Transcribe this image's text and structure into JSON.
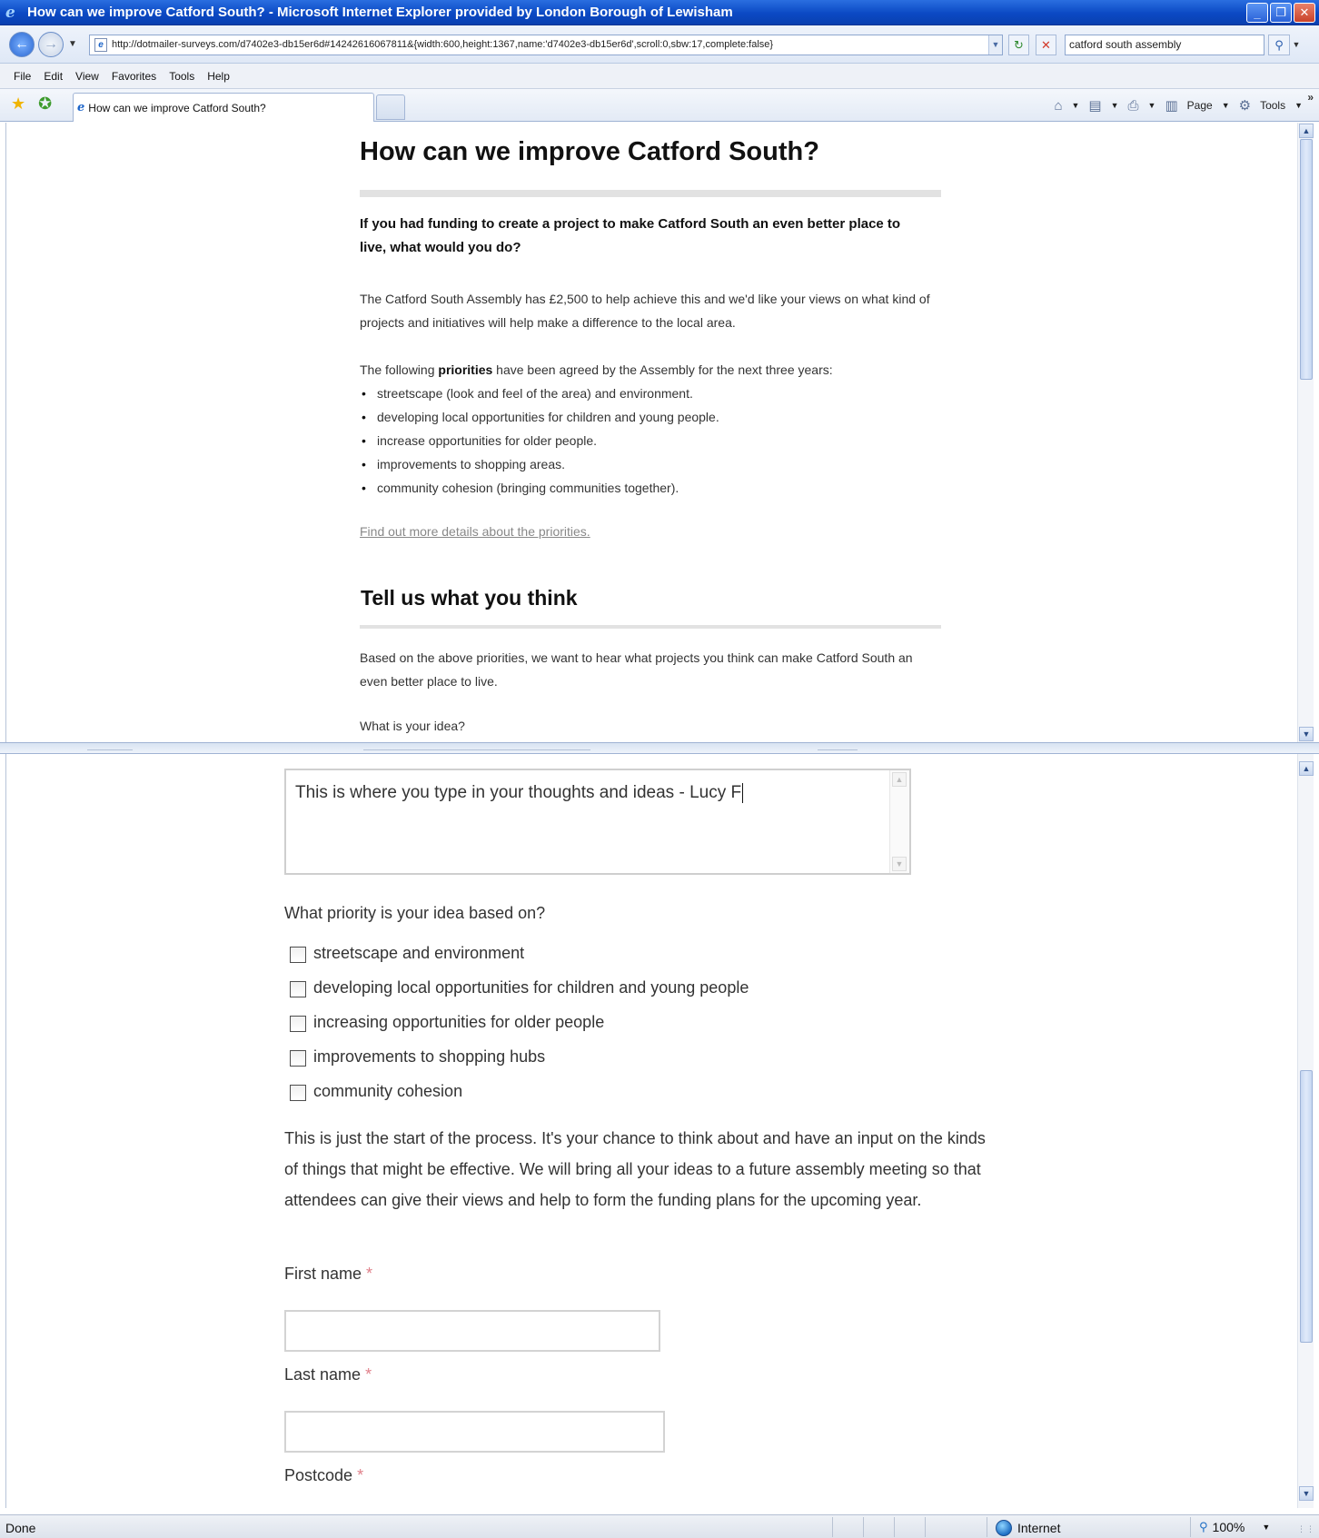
{
  "window": {
    "title": "How can we improve Catford South? - Microsoft Internet Explorer provided by London Borough of Lewisham",
    "minimize_glyph": "_",
    "restore_glyph": "❐",
    "close_glyph": "✕"
  },
  "address_bar": {
    "url": "http://dotmailer-surveys.com/d7402e3-db15er6d#14242616067811&{width:600,height:1367,name:'d7402e3-db15er6d',scroll:0,sbw:17,complete:false}",
    "search_value": "catford south assembly"
  },
  "menu": {
    "items": [
      "File",
      "Edit",
      "View",
      "Favorites",
      "Tools",
      "Help"
    ]
  },
  "toolbar": {
    "tab_label": "How can we improve Catford South?",
    "page_label": "Page",
    "tools_label": "Tools"
  },
  "page": {
    "title": "How can we improve Catford South?",
    "lead": "If you had funding to create a project to make Catford South an even better place to live, what would you do?",
    "intro": "The Catford South Assembly has £2,500 to help achieve this and we'd like your views on what kind of projects and initiatives will help make a difference to the local area.",
    "priorities_intro_before": "The following ",
    "priorities_intro_bold": "priorities",
    "priorities_intro_after": " have been agreed by the Assembly for the next three years:",
    "priorities": [
      "streetscape (look and feel of the area) and environment.",
      "developing local opportunities for children and young people.",
      "increase opportunities for older people.",
      "improvements to shopping areas.",
      "community cohesion (bringing communities together)."
    ],
    "more_link": "Find out more details about the priorities.",
    "section_title": "Tell us what you think",
    "section_intro": "Based on the above priorities, we want to hear what projects you think can make Catford South an even better place to live.",
    "idea_question": "What is your idea?"
  },
  "form": {
    "idea_value": "This is where you type in your thoughts and ideas - Lucy F",
    "priority_question": "What priority is your idea based on?",
    "priority_options": [
      "streetscape and environment",
      "developing local opportunities for children and young people",
      "increasing opportunities for older people",
      "improvements to shopping hubs",
      "community cohesion"
    ],
    "process_text": "This is just the start of the process. It's your chance to think about and have an input on the kinds of things that might be effective. We will bring all your ideas to a future assembly meeting so that attendees can give their views and help to form the funding plans for the upcoming year.",
    "first_name_label": "First name",
    "last_name_label": "Last name",
    "postcode_label": "Postcode",
    "required_mark": "*",
    "first_name_value": "",
    "last_name_value": ""
  },
  "status": {
    "text": "Done",
    "zone": "Internet",
    "zoom": "100%"
  },
  "colors": {
    "title_bar": "#0b49c4",
    "required_mark": "#e0808a",
    "link": "#888888"
  }
}
